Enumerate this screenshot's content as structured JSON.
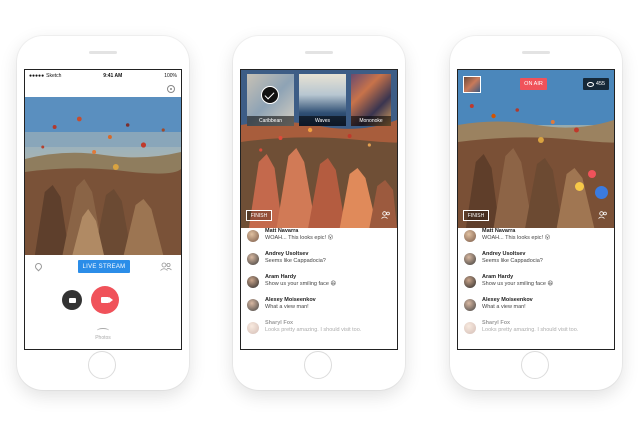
{
  "phone1": {
    "status": {
      "carrier": "Sketch",
      "time": "9:41 AM",
      "battery": "100%"
    },
    "live_stream_label": "LIVE STREAM",
    "photos_label": "Photos"
  },
  "phone2": {
    "filters": [
      {
        "label": "Caribbean",
        "selected": true
      },
      {
        "label": "Waves",
        "selected": false
      },
      {
        "label": "Mononoke",
        "selected": false
      }
    ],
    "finish_label": "FINISH",
    "comments": [
      {
        "name": "Matt Navarra",
        "message": "WOAH... This looks epic! 😮"
      },
      {
        "name": "Andrey Usoltsev",
        "message": "Seems like Cappadocia?"
      },
      {
        "name": "Aram Hardy",
        "message": "Show us your smiling face 😄"
      },
      {
        "name": "Alexey Moiseenkov",
        "message": "What a view man!"
      },
      {
        "name": "Sharyl Fox",
        "message": "Looks pretty amazing. I should visit too."
      }
    ]
  },
  "phone3": {
    "on_air_label": "ON AIR",
    "viewers_count": "455",
    "finish_label": "FINISH",
    "comments": [
      {
        "name": "Matt Navarra",
        "message": "WOAH... This looks epic! 😮"
      },
      {
        "name": "Andrey Usoltsev",
        "message": "Seems like Cappadocia?"
      },
      {
        "name": "Aram Hardy",
        "message": "Show us your smiling face 😄"
      },
      {
        "name": "Alexey Moiseenkov",
        "message": "What a view man!"
      },
      {
        "name": "Sharyl Fox",
        "message": "Looks pretty amazing. I should visit too."
      }
    ]
  },
  "colors": {
    "accent_blue": "#2b8de8",
    "record_red": "#f0525a",
    "on_air_red": "#f0525a"
  }
}
